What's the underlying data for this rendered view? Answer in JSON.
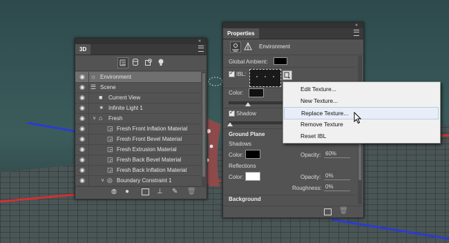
{
  "panel3d": {
    "tab": "3D",
    "toolbar_icons": [
      "scene-filter-icon",
      "mesh-filter-icon",
      "material-filter-icon",
      "light-filter-icon"
    ],
    "layers": [
      {
        "label": "Environment",
        "indent": 0,
        "icon": "environment-icon",
        "selected": true
      },
      {
        "label": "Scene",
        "indent": 0,
        "icon": "scene-icon"
      },
      {
        "label": "Current View",
        "indent": 1,
        "icon": "camera-icon"
      },
      {
        "label": "Infinite Light 1",
        "indent": 1,
        "icon": "light-icon"
      },
      {
        "label": "Fresh",
        "indent": 1,
        "icon": "mesh-icon",
        "expander": "v"
      },
      {
        "label": "Fresh Front Inflation Material",
        "indent": 2,
        "icon": "material-icon"
      },
      {
        "label": "Fresh Front Bevel Material",
        "indent": 2,
        "icon": "material-icon"
      },
      {
        "label": "Fresh Extrusion Material",
        "indent": 2,
        "icon": "material-icon"
      },
      {
        "label": "Fresh Back Bevel Material",
        "indent": 2,
        "icon": "material-icon"
      },
      {
        "label": "Fresh Back Inflation Material",
        "indent": 2,
        "icon": "material-icon"
      },
      {
        "label": "Boundary Constraint 1",
        "indent": 2,
        "icon": "constraint-icon",
        "expander": "v"
      }
    ],
    "bottom_icons": [
      "scene-options-icon",
      "light-add-icon",
      "render-icon",
      "ground-icon",
      "bulb-icon",
      "trash-icon"
    ]
  },
  "properties": {
    "tab": "Properties",
    "section_title": "Environment",
    "global_ambient_label": "Global Ambient:",
    "ibl_label": "IBL:",
    "color_label": "Color:",
    "shadow_label": "Shadow",
    "ground_plane_label": "Ground Plane",
    "shadows_label": "Shadows",
    "shadows_color_label": "Color:",
    "opacity_label": "Opacity:",
    "shadows_opacity_value": "60%",
    "reflections_label": "Reflections",
    "reflections_color_label": "Color:",
    "reflections_opacity_label": "Opacity:",
    "reflections_opacity_value": "0%",
    "roughness_label": "Roughness:",
    "roughness_value": "0%",
    "background_label": "Background"
  },
  "context_menu": {
    "items": [
      "Edit Texture...",
      "New Texture...",
      "Replace Texture...",
      "Remove Texture",
      "Reset IBL"
    ],
    "highlighted_index": 2
  },
  "colors": {
    "panel_bg": "#535353",
    "menu_bg": "#f0f0f0",
    "menu_highlight": "#e8eef7",
    "selected_row": "#6f6f6f"
  }
}
